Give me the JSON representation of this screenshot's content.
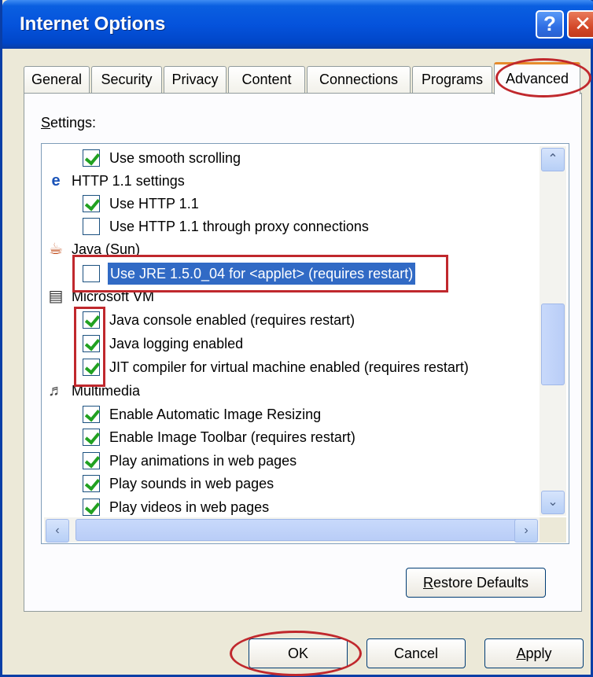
{
  "window": {
    "title": "Internet Options",
    "help_glyph": "?",
    "close_glyph": "✕"
  },
  "tabs": [
    {
      "label": "General"
    },
    {
      "label": "Security"
    },
    {
      "label": "Privacy"
    },
    {
      "label": "Content"
    },
    {
      "label": "Connections"
    },
    {
      "label": "Programs"
    },
    {
      "label": "Advanced"
    }
  ],
  "active_tab": "Advanced",
  "settings_label": {
    "accel": "S",
    "rest": "ettings:"
  },
  "settings": {
    "rows": [
      {
        "kind": "item",
        "label": "Use smooth scrolling",
        "checked": true
      },
      {
        "kind": "group",
        "label": "HTTP 1.1 settings",
        "icon": "ie-icon"
      },
      {
        "kind": "item",
        "label": "Use HTTP 1.1",
        "checked": true
      },
      {
        "kind": "item",
        "label": "Use HTTP 1.1 through proxy connections",
        "checked": false
      },
      {
        "kind": "group",
        "label": "Java (Sun)",
        "icon": "java-cup-icon"
      },
      {
        "kind": "item",
        "label": "Use JRE 1.5.0_04 for <applet> (requires restart)",
        "checked": false,
        "selected": true
      },
      {
        "kind": "group",
        "label": "Microsoft VM",
        "icon": "document-icon"
      },
      {
        "kind": "item",
        "label": "Java console enabled (requires restart)",
        "checked": true
      },
      {
        "kind": "item",
        "label": "Java logging enabled",
        "checked": true
      },
      {
        "kind": "item",
        "label": "JIT compiler for virtual machine enabled (requires restart)",
        "checked": true
      },
      {
        "kind": "group",
        "label": "Multimedia",
        "icon": "multimedia-icon"
      },
      {
        "kind": "item",
        "label": "Enable Automatic Image Resizing",
        "checked": true
      },
      {
        "kind": "item",
        "label": "Enable Image Toolbar (requires restart)",
        "checked": true
      },
      {
        "kind": "item",
        "label": "Play animations in web pages",
        "checked": true
      },
      {
        "kind": "item",
        "label": "Play sounds in web pages",
        "checked": true
      },
      {
        "kind": "item",
        "label": "Play videos in web pages",
        "checked": true
      }
    ]
  },
  "scroll": {
    "up": "⌃",
    "down": "⌄",
    "left": "‹",
    "right": "›"
  },
  "buttons": {
    "restore": {
      "accel": "R",
      "rest": "estore Defaults"
    },
    "ok": "OK",
    "cancel": "Cancel",
    "apply": {
      "accel": "A",
      "rest": "pply"
    }
  },
  "colors": {
    "title_bar": "#0553dc",
    "annotation_red": "#c0282d",
    "checkbox_green": "#21a121",
    "selection": "#316ac5"
  }
}
